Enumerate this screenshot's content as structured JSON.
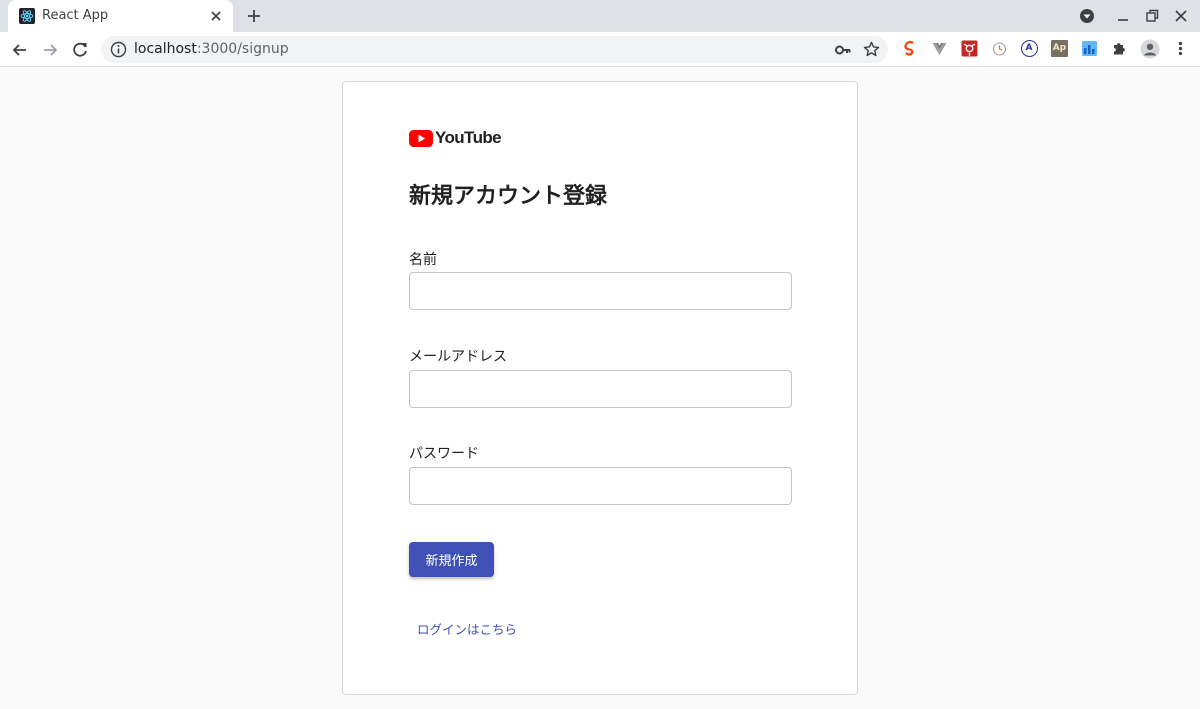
{
  "browser": {
    "tab_title": "React App",
    "url_host": "localhost",
    "url_rest": ":3000/signup"
  },
  "icons": {
    "tab": [
      "react-favicon-icon",
      "close-icon",
      "plus-icon"
    ],
    "window": [
      "profile-dropdown-icon",
      "minimize-icon",
      "restore-icon",
      "close-window-icon"
    ],
    "toolbar": [
      "back-arrow-icon",
      "forward-arrow-icon",
      "reload-icon",
      "info-icon",
      "key-icon",
      "star-icon",
      "puzzle-icon",
      "profile-icon",
      "kebab-menu-icon"
    ],
    "extensions": [
      "svelte-icon",
      "vue-icon",
      "redux-icon",
      "timer-icon",
      "a-circle-icon",
      "ap-icon",
      "wave-icon"
    ]
  },
  "extensions": {
    "a_circle": "A",
    "ap": "Ap"
  },
  "colors": {
    "primary": "#3f51b5",
    "youtube_red": "#ff0000",
    "background": "#fafafa"
  },
  "signup": {
    "logo_text": "YouTube",
    "title": "新規アカウント登録",
    "fields": [
      {
        "label": "名前",
        "value": "",
        "placeholder": ""
      },
      {
        "label": "メールアドレス",
        "value": "",
        "placeholder": ""
      },
      {
        "label": "パスワード",
        "value": "",
        "placeholder": ""
      }
    ],
    "submit_label": "新規作成",
    "login_link": "ログインはこちら"
  }
}
